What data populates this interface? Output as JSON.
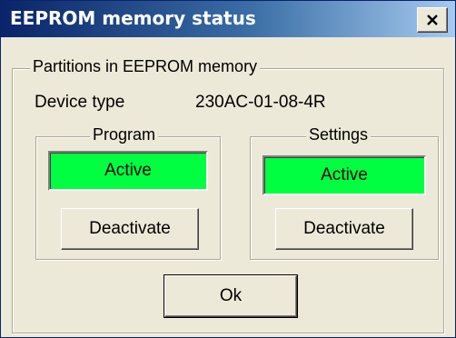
{
  "window": {
    "title": "EEPROM memory status",
    "close_label": "×"
  },
  "partitions": {
    "legend": "Partitions in EEPROM memory",
    "device_type_label": "Device type",
    "device_type_value": "230AC-01-08-4R"
  },
  "program": {
    "legend": "Program",
    "status": "Active",
    "button_label": "Deactivate"
  },
  "settings": {
    "legend": "Settings",
    "status": "Active",
    "button_label": "Deactivate"
  },
  "footer": {
    "ok_label": "Ok"
  },
  "colors": {
    "active_status": "#00ff40",
    "title_bar": "#0a246a",
    "dialog_background": "#ece9d8"
  }
}
